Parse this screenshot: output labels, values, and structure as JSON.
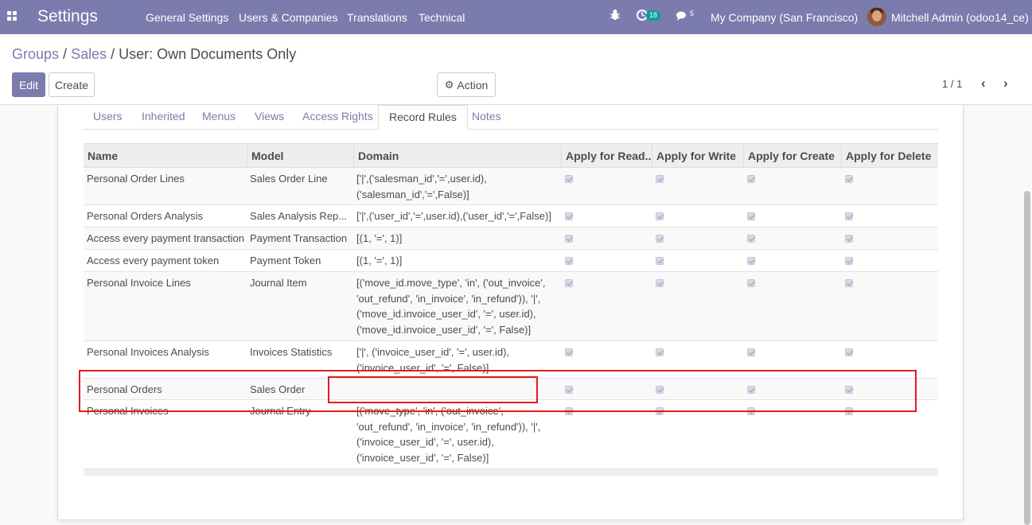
{
  "navbar": {
    "app_title": "Settings",
    "menu": [
      "General Settings",
      "Users & Companies",
      "Translations",
      "Technical"
    ],
    "activity_count": "18",
    "message_count": "5",
    "company": "My Company (San Francisco)",
    "user": "Mitchell Admin (odoo14_ce)",
    "accent_color": "#7c7bad"
  },
  "breadcrumb": {
    "groups": "Groups",
    "sep1": "/",
    "sales": "Sales",
    "sep2": "/",
    "current": "User: Own Documents Only"
  },
  "toolbar": {
    "edit_label": "Edit",
    "create_label": "Create",
    "action_label": "Action",
    "pager": "1 / 1"
  },
  "tabs": [
    "Users",
    "Inherited",
    "Menus",
    "Views",
    "Access Rights",
    "Record Rules",
    "Notes"
  ],
  "active_tab": "Record Rules",
  "table": {
    "columns": [
      "Name",
      "Model",
      "Domain",
      "Apply for Read...",
      "Apply for Write",
      "Apply for Create",
      "Apply for Delete"
    ],
    "rows": [
      {
        "name": "Personal Order Lines",
        "model": "Sales Order Line",
        "domain": "['|',('salesman_id','=',user.id),('salesman_id','=',False)]",
        "read": true,
        "write": true,
        "create": true,
        "delete": true
      },
      {
        "name": "Personal Orders Analysis",
        "model": "Sales Analysis Rep...",
        "domain": "['|',('user_id','=',user.id),('user_id','=',False)]",
        "read": true,
        "write": true,
        "create": true,
        "delete": true
      },
      {
        "name": "Access every payment transaction",
        "model": "Payment Transaction",
        "domain": "[(1, '=', 1)]",
        "read": true,
        "write": true,
        "create": true,
        "delete": true
      },
      {
        "name": "Access every payment token",
        "model": "Payment Token",
        "domain": "[(1, '=', 1)]",
        "read": true,
        "write": true,
        "create": true,
        "delete": true
      },
      {
        "name": "Personal Invoice Lines",
        "model": "Journal Item",
        "domain": "[('move_id.move_type', 'in', ('out_invoice', 'out_refund', 'in_invoice', 'in_refund')), '|', ('move_id.invoice_user_id', '=', user.id), ('move_id.invoice_user_id', '=', False)]",
        "read": true,
        "write": true,
        "create": true,
        "delete": true
      },
      {
        "name": "Personal Invoices Analysis",
        "model": "Invoices Statistics",
        "domain": "['|', ('invoice_user_id', '=', user.id), ('invoice_user_id', '=', False)]",
        "read": true,
        "write": true,
        "create": true,
        "delete": true
      },
      {
        "name": "Personal Orders",
        "model": "Sales Order",
        "domain": "",
        "read": true,
        "write": true,
        "create": true,
        "delete": true
      },
      {
        "name": "Personal Invoices",
        "model": "Journal Entry",
        "domain": "[('move_type', 'in', ('out_invoice', 'out_refund', 'in_invoice', 'in_refund')), '|', ('invoice_user_id', '=', user.id), ('invoice_user_id', '=', False)]",
        "read": true,
        "write": true,
        "create": true,
        "delete": true
      }
    ]
  },
  "annotation_color": "#e21b1b"
}
